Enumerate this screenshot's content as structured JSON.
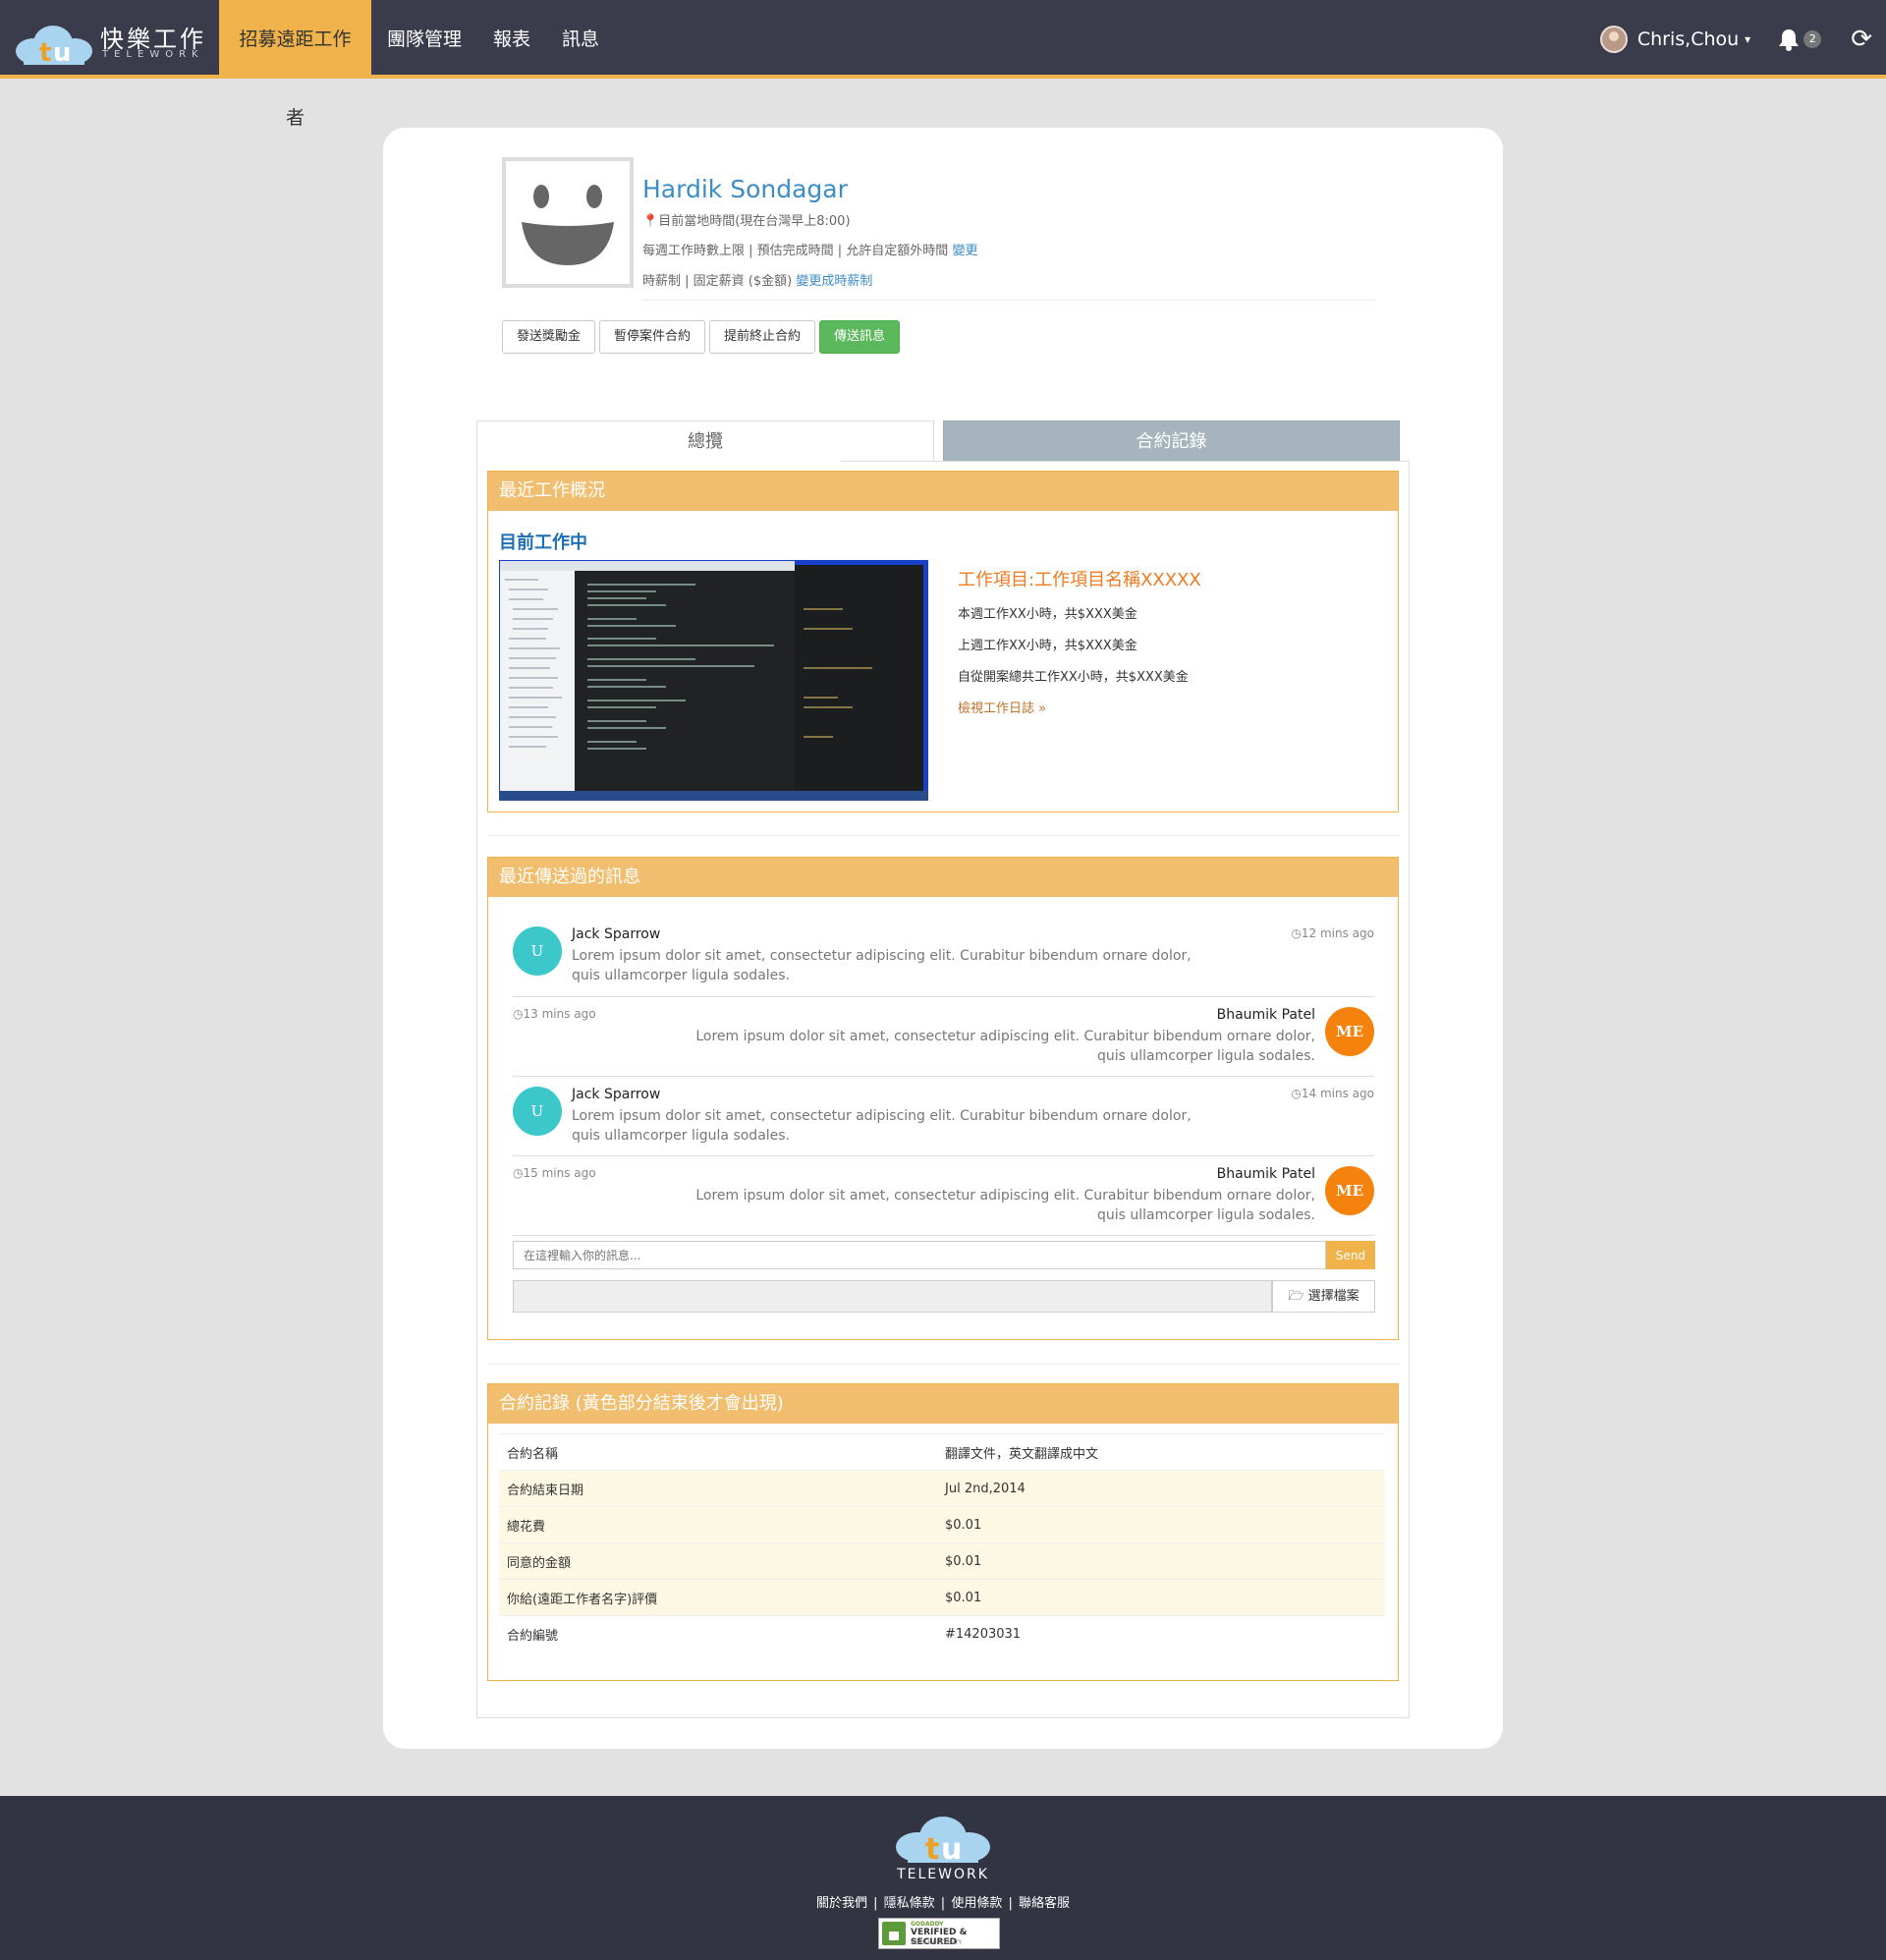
{
  "navbar": {
    "brand": "快樂工作",
    "brand_sub": "TELEWORK",
    "items": [
      {
        "label": "招募遠距工作者",
        "active": true
      },
      {
        "label": "團隊管理"
      },
      {
        "label": "報表"
      },
      {
        "label": "訊息"
      }
    ],
    "user_name": "Chris,Chou",
    "notification_count": "2"
  },
  "profile": {
    "name": "Hardik Sondagar",
    "local_time": "目前當地時間(現在台灣早上8:00)",
    "hours_line": "每週工作時數上限 | 預估完成時間 | 允許自定額外時間",
    "hours_link": "變更",
    "pay_line": "時薪制 | 固定薪資 ($金額)",
    "pay_link": "變更成時薪制"
  },
  "actions": {
    "bonus": "發送獎勵金",
    "pause": "暫停案件合約",
    "terminate": "提前終止合約",
    "message": "傳送訊息"
  },
  "tabs": {
    "overview": "總攬",
    "contracts": "合約記錄"
  },
  "recent_work": {
    "heading": "最近工作概況",
    "current_label": "目前工作中",
    "project_title": "工作項目:工作項目名稱XXXXX",
    "this_week": "本週工作XX小時，共$XXX美金",
    "last_week": "上週工作XX小時，共$XXX美金",
    "total": "自從開案總共工作XX小時，共$XXX美金",
    "log_link": "檢視工作日誌 »"
  },
  "messages": {
    "heading": "最近傳送過的訊息",
    "items": [
      {
        "side": "left",
        "avatar": "U",
        "name": "Jack Sparrow",
        "time": "12 mins ago",
        "text": "Lorem ipsum dolor sit amet, consectetur adipiscing elit. Curabitur bibendum ornare dolor, quis ullamcorper ligula sodales."
      },
      {
        "side": "right",
        "avatar": "ME",
        "name": "Bhaumik Patel",
        "time": "13 mins ago",
        "text": "Lorem ipsum dolor sit amet, consectetur adipiscing elit. Curabitur bibendum ornare dolor, quis ullamcorper ligula sodales."
      },
      {
        "side": "left",
        "avatar": "U",
        "name": "Jack Sparrow",
        "time": "14 mins ago",
        "text": "Lorem ipsum dolor sit amet, consectetur adipiscing elit. Curabitur bibendum ornare dolor, quis ullamcorper ligula sodales."
      },
      {
        "side": "right",
        "avatar": "ME",
        "name": "Bhaumik Patel",
        "time": "15 mins ago",
        "text": "Lorem ipsum dolor sit amet, consectetur adipiscing elit. Curabitur bibendum ornare dolor, quis ullamcorper ligula sodales."
      }
    ],
    "input_placeholder": "在這裡輸入你的訊息...",
    "send_label": "Send",
    "file_label": "選擇檔案"
  },
  "contract": {
    "heading": "合約記錄 (黃色部分結束後才會出現)",
    "rows": [
      {
        "label": "合約名稱",
        "value": "翻譯文件，英文翻譯成中文"
      },
      {
        "label": "合約結束日期",
        "value": "Jul 2nd,2014"
      },
      {
        "label": "總花費",
        "value": "$0.01"
      },
      {
        "label": "同意的金額",
        "value": "$0.01"
      },
      {
        "label": "你給(遠距工作者名字)評價",
        "value": "$0.01"
      },
      {
        "label": "合約編號",
        "value": "#14203031"
      }
    ]
  },
  "footer": {
    "brand": "TELEWORK",
    "links": [
      "關於我們",
      "隱私條款",
      "使用條款",
      "聯絡客服"
    ],
    "seal_line1": "GODADDY",
    "seal_line2": "VERIFIED & SECURED",
    "seal_line3": "VERIFY SECURITY"
  },
  "colors": {
    "navbar": "#3a3c4b",
    "accent": "#f0b24b",
    "panel_head": "#f0be6e",
    "link": "#3b8dc7",
    "success": "#5cb85c"
  }
}
